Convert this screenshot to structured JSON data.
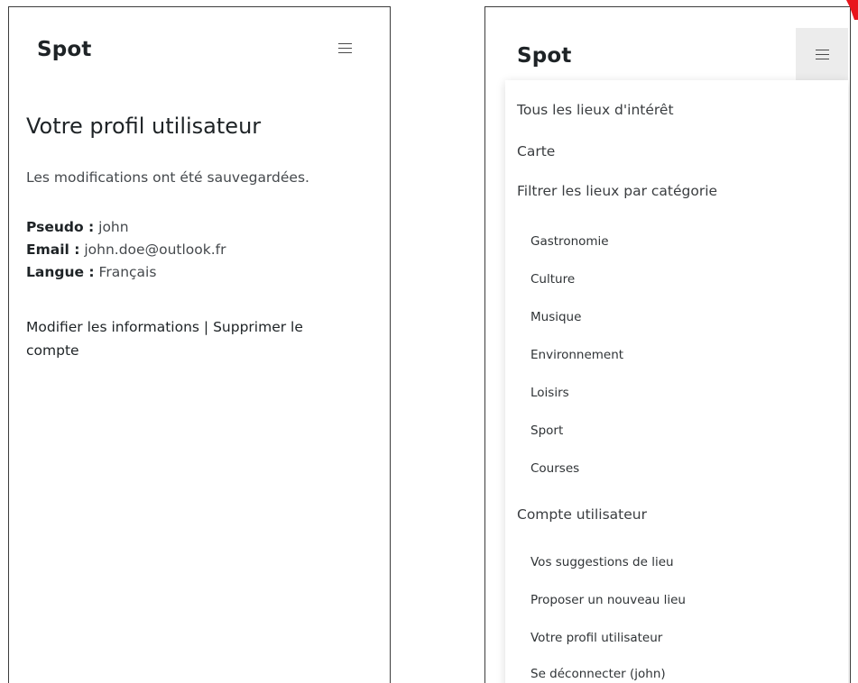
{
  "left_screen": {
    "brand": "Spot",
    "page_title": "Votre profil utilisateur",
    "success_message": "Les modifications ont été sauvegardées.",
    "profile": {
      "pseudo_label": "Pseudo :",
      "pseudo_value": "john",
      "email_label": "Email :",
      "email_value": "john.doe@outlook.fr",
      "langue_label": "Langue :",
      "langue_value": "Français"
    },
    "actions": {
      "edit_label": "Modifier les informations",
      "separator": "|",
      "delete_label": "Supprimer le compte"
    }
  },
  "right_screen": {
    "brand": "Spot",
    "menu": {
      "all_places": "Tous les lieux d'intérêt",
      "map": "Carte",
      "filter_header": "Filtrer les lieux par catégorie",
      "categories": [
        "Gastronomie",
        "Culture",
        "Musique",
        "Environnement",
        "Loisirs",
        "Sport",
        "Courses"
      ],
      "account_header": "Compte utilisateur",
      "account_items": [
        "Vos suggestions de lieu",
        "Proposer un nouveau lieu",
        "Votre profil utilisateur",
        "Se déconnecter (john)"
      ]
    }
  },
  "colors": {
    "text": "#212529",
    "hamburger_active_bg": "#ececec",
    "pointer_arrow": "#e8141c"
  },
  "icons": {
    "menu_toggle": "hamburger-icon",
    "pointer": "red-arrow-pointer"
  }
}
